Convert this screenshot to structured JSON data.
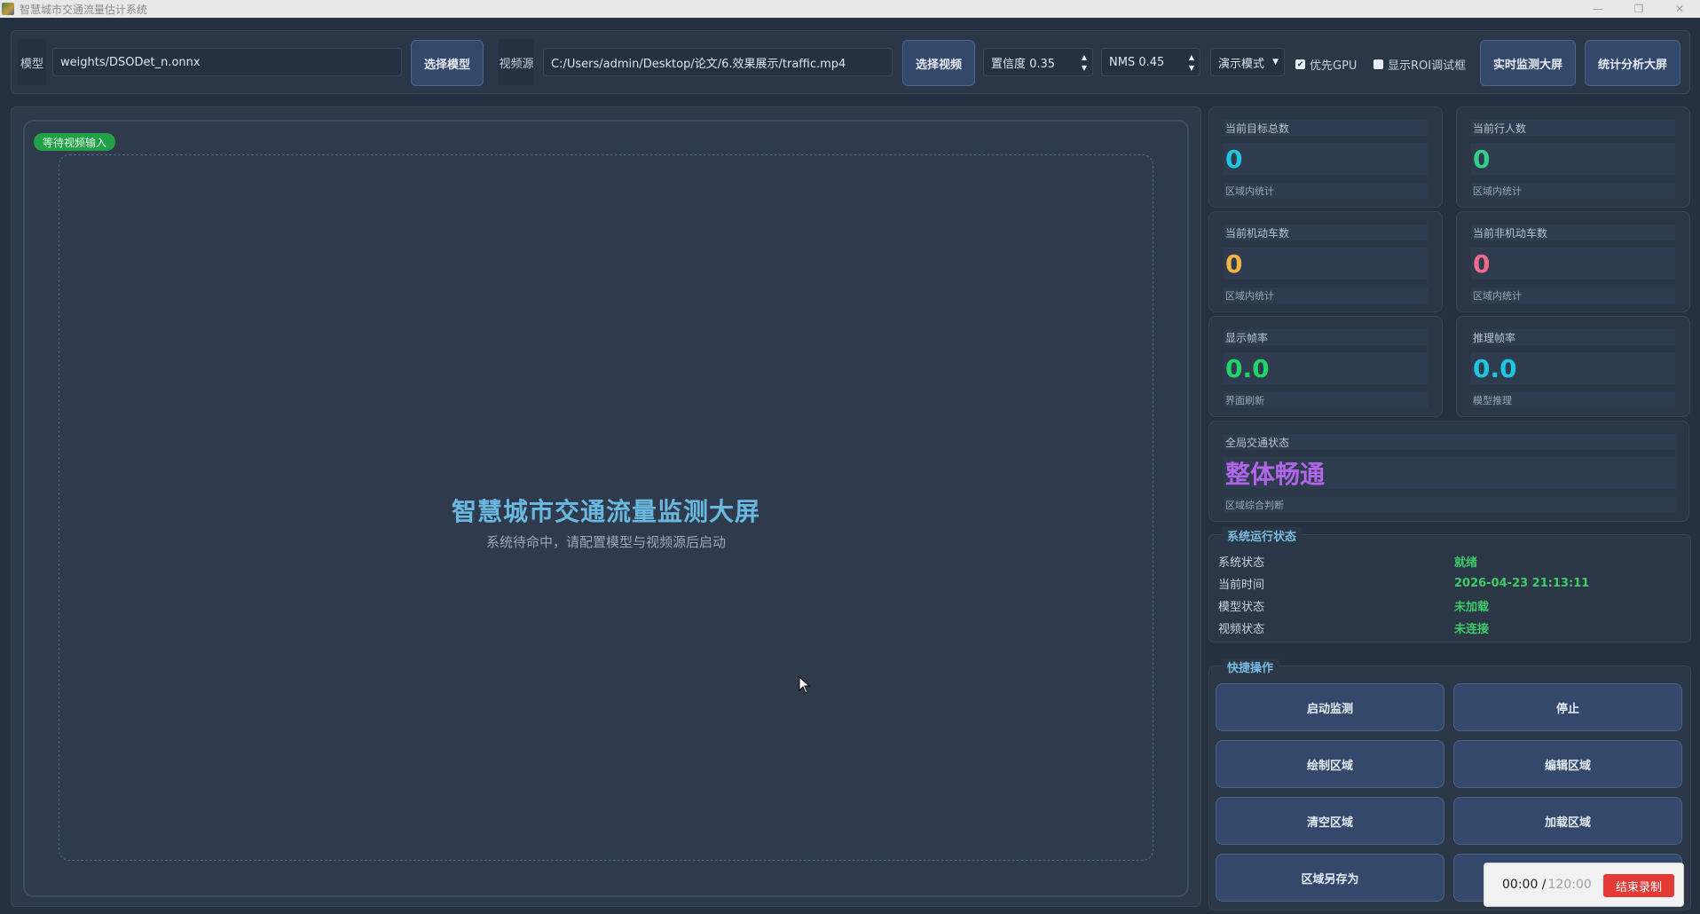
{
  "window": {
    "title": "智慧城市交通流量估计系统",
    "controls": [
      "—",
      "❐",
      "✕"
    ]
  },
  "toolbar": {
    "model_label": "模型",
    "model_path": "weights/DSODet_n.onnx",
    "select_model": "选择模型",
    "source_label": "视频源",
    "source_path": "C:/Users/admin/Desktop/论文/6.效果展示/traffic.mp4",
    "select_video": "选择视频",
    "confidence": "置信度 0.35",
    "nms": "NMS 0.45",
    "mode": "演示模式",
    "gpu_label": "优先GPU",
    "gpu_checked": true,
    "roi_label": "显示ROI调试框",
    "roi_checked": false,
    "realtime_screen": "实时监测大屏",
    "stats_screen": "统计分析大屏"
  },
  "video": {
    "status_pill": "等待视频输入",
    "title": "智慧城市交通流量监测大屏",
    "subtitle": "系统待命中，请配置模型与视频源后启动"
  },
  "cards": [
    {
      "title": "当前目标总数",
      "value": "0",
      "sub": "区域内统计",
      "color": "#1fc6e0"
    },
    {
      "title": "当前行人数",
      "value": "0",
      "sub": "区域内统计",
      "color": "#34d08a"
    },
    {
      "title": "当前机动车数",
      "value": "0",
      "sub": "区域内统计",
      "color": "#f2b443"
    },
    {
      "title": "当前非机动车数",
      "value": "0",
      "sub": "区域内统计",
      "color": "#ee6b8b"
    },
    {
      "title": "显示帧率",
      "value": "0.0",
      "sub": "界面刷新",
      "color": "#22d36c"
    },
    {
      "title": "推理帧率",
      "value": "0.0",
      "sub": "模型推理",
      "color": "#1fc6e0"
    },
    {
      "title": "全局交通状态",
      "value": "整体畅通",
      "sub": "区域综合判断",
      "color": "#b066e8"
    }
  ],
  "system_status": {
    "title": "系统运行状态",
    "rows": [
      {
        "key": "系统状态",
        "value": "就绪"
      },
      {
        "key": "当前时间",
        "value": "2026-04-23 21:13:11"
      },
      {
        "key": "模型状态",
        "value": "未加载"
      },
      {
        "key": "视频状态",
        "value": "未连接"
      }
    ]
  },
  "quick_ops": {
    "title": "快捷操作",
    "buttons": [
      "启动监测",
      "停止",
      "绘制区域",
      "编辑区域",
      "清空区域",
      "加载区域",
      "区域另存为"
    ]
  },
  "recording": {
    "elapsed": "00:00 /",
    "total": "120:00",
    "stop_label": "结束录制"
  }
}
